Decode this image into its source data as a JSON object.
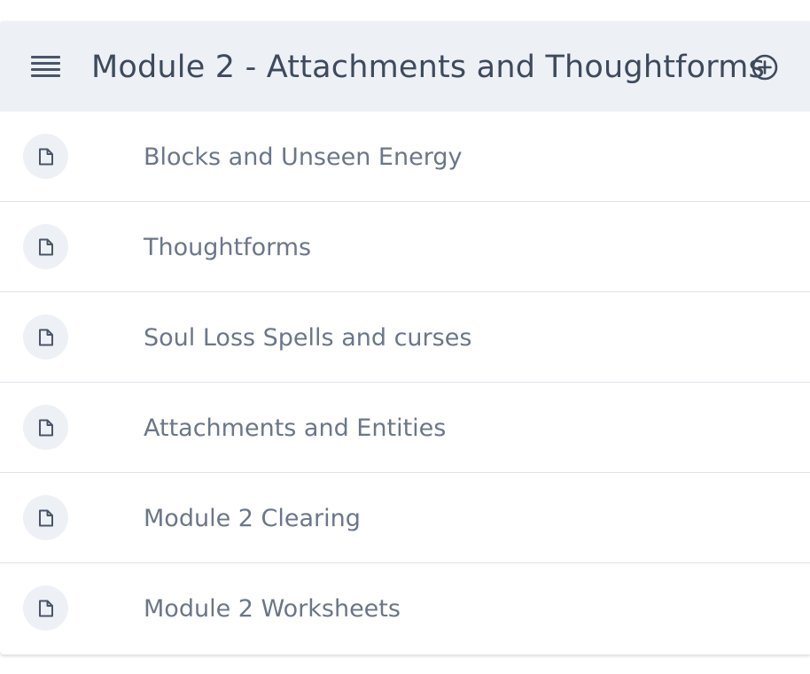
{
  "module": {
    "title": "Module 2 - Attachments and Thoughtforms",
    "menu_icon": "menu-lines-icon",
    "add_icon": "plus-circle-icon"
  },
  "lessons": [
    {
      "title": "Blocks and Unseen Energy",
      "icon": "document-icon"
    },
    {
      "title": "Thoughtforms",
      "icon": "document-icon"
    },
    {
      "title": "Soul Loss Spells and curses",
      "icon": "document-icon"
    },
    {
      "title": "Attachments and Entities",
      "icon": "document-icon"
    },
    {
      "title": "Module 2 Clearing",
      "icon": "document-icon"
    },
    {
      "title": "Module 2 Worksheets",
      "icon": "document-icon"
    }
  ],
  "colors": {
    "header_background": "#edf1f6",
    "title_text": "#3e4a5c",
    "lesson_text": "#6b7689",
    "icon_circle": "#edf1f5",
    "divider": "#dde3ea"
  }
}
